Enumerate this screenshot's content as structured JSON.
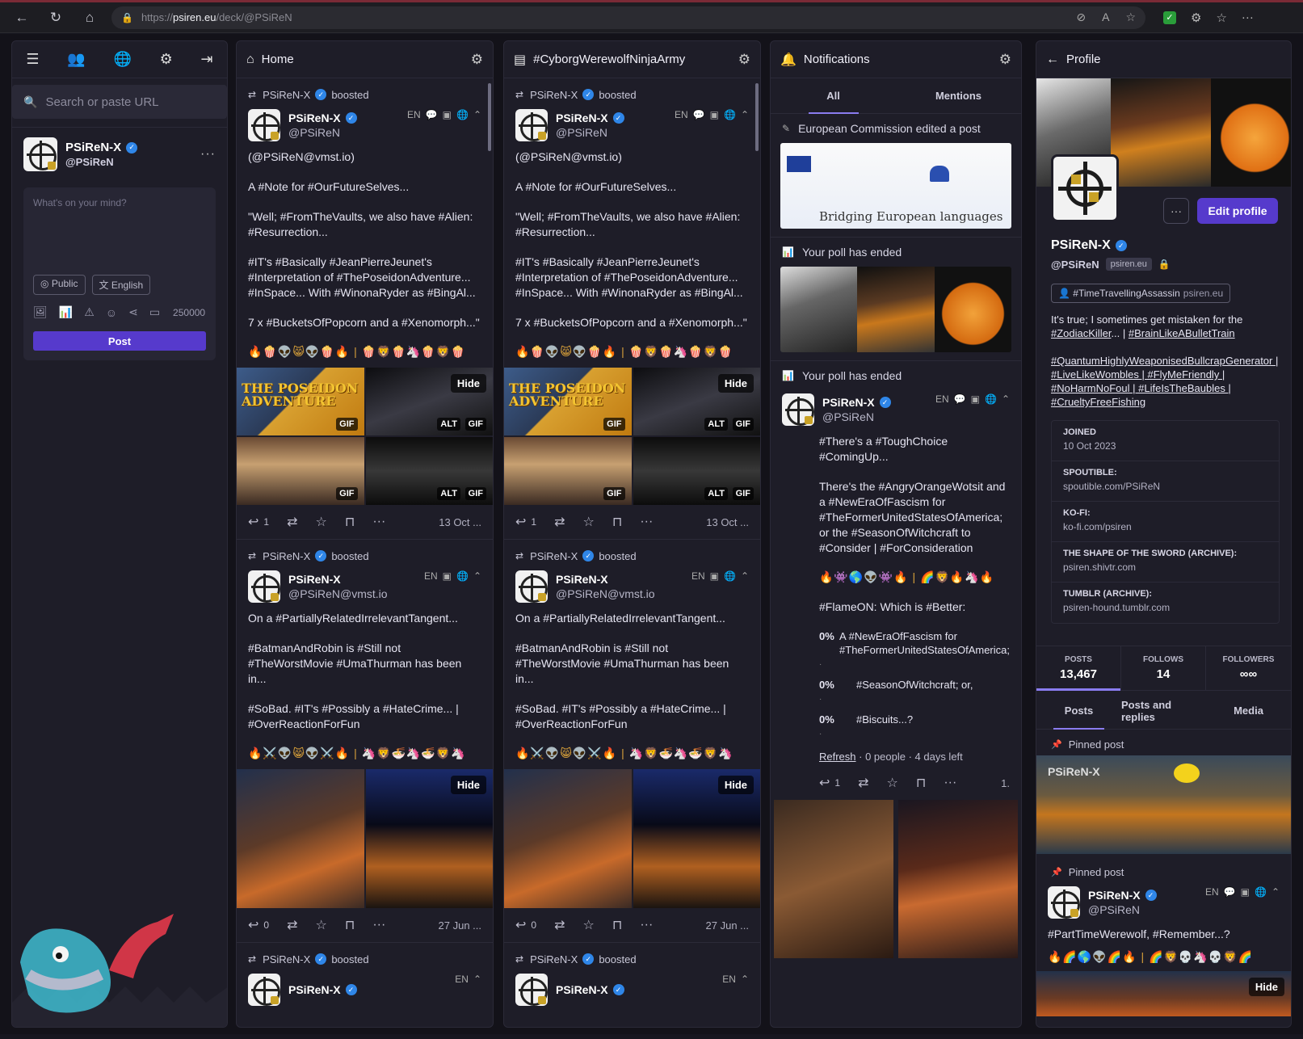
{
  "browser": {
    "url_proto": "https://",
    "url_domain": "psiren.eu",
    "url_path": "/deck/@PSiReN"
  },
  "sidebar": {
    "search_placeholder": "Search or paste URL",
    "user": {
      "display_name": "PSiReN-X",
      "handle": "@PSiReN"
    },
    "compose": {
      "placeholder": "What's on your mind?",
      "visibility": "Public",
      "language": "English",
      "char_count": "250000",
      "post_label": "Post"
    }
  },
  "home": {
    "title": "Home",
    "posts": [
      {
        "boost_user": "PSiReN-X",
        "boost_label": "boosted",
        "display_name": "PSiReN-X",
        "handle": "@PSiReN",
        "lang": "EN",
        "paragraphs": [
          "(@PSiReN@vmst.io)",
          "A #Note for #OurFutureSelves...",
          "\"Well; #FromTheVaults, we also have #Alien: #Resurrection...",
          "#IT's #Basically #JeanPierreJeunet's #Interpretation of  #ThePoseidonAdventure... #InSpace... With #WinonaRyder as #BingAl...",
          "7 x #BucketsOfPopcorn and a #Xenomorph...\""
        ],
        "emoji": "🔥🍿👽😸👽🍿🔥 | 🍿🦁🍿🦄🍿🦁🍿",
        "media_title": "THE POSEIDON ADVENTURE",
        "badge_gif": "GIF",
        "badge_alt": "ALT",
        "hide_label": "Hide",
        "replies": "1",
        "date": "13 Oct ..."
      },
      {
        "boost_user": "PSiReN-X",
        "boost_label": "boosted",
        "display_name": "PSiReN-X",
        "handle": "@PSiReN@vmst.io",
        "lang": "EN",
        "paragraphs": [
          "On a #PartiallyRelatedIrrelevantTangent...",
          "#BatmanAndRobin is #Still not #TheWorstMovie #UmaThurman has been in...",
          "#SoBad. #IT's #Possibly a #HateCrime...  | #OverReactionForFun"
        ],
        "emoji": "🔥⚔️👽😸👽⚔️🔥 | 🦄🦁🍜🦄🍜🦁🦄",
        "hide_label": "Hide",
        "replies": "0",
        "date": "27 Jun ..."
      },
      {
        "boost_user": "PSiReN-X",
        "boost_label": "boosted",
        "display_name": "PSiReN-X",
        "lang": "EN"
      }
    ]
  },
  "hashtag_col": {
    "title": "#CyborgWerewolfNinjaArmy"
  },
  "notifications": {
    "title": "Notifications",
    "tab_all": "All",
    "tab_mentions": "Mentions",
    "edit_notice": "European Commission edited a post",
    "eu_image_text": "Bridging European languages",
    "poll_ended_1": "Your poll has ended",
    "poll_ended_2": "Your poll has ended",
    "poll_post": {
      "display_name": "PSiReN-X",
      "handle": "@PSiReN",
      "lang": "EN",
      "paragraphs": [
        "#There's a #ToughChoice #ComingUp...",
        "There's the #AngryOrangeWotsit and a #NewEraOfFascism for #TheFormerUnitedStatesOfAmerica; or the #SeasonOfWitchcraft to #Consider | #ForConsideration"
      ],
      "emoji": "🔥👾🌎👽👾🔥 | 🌈🦁🔥🦄🔥",
      "question": "#FlameON: Which is #Better:",
      "options": [
        {
          "pct": "0%",
          "label": "A #NewEraOfFascism for #TheFormerUnitedStatesOfAmerica;"
        },
        {
          "pct": "0%",
          "label": "#SeasonOfWitchcraft; or,"
        },
        {
          "pct": "0%",
          "label": "#Biscuits...?"
        }
      ],
      "refresh": "Refresh",
      "poll_meta": " · 0 people · 4 days left",
      "replies": "1",
      "date": "1."
    }
  },
  "profile": {
    "title": "Profile",
    "display_name": "PSiReN-X",
    "handle": "@PSiReN",
    "domain": "psiren.eu",
    "edit_label": "Edit profile",
    "tag_pill": "#TimeTravellingAssassin",
    "tag_pill_domain": "psiren.eu",
    "bio_line1": "It's true; I sometimes get mistaken for the ",
    "bio_tag1": "#ZodiacKiller",
    "bio_mid": "... | ",
    "bio_tag2": "#BrainLikeABulletTrain",
    "bio_tags": "#QuantumHighlyWeaponisedBullcrapGenerator | #LiveLikeWombles | #FlyMeFriendly | #NoHarmNoFoul | #LifeIsTheBaubles | #CrueltyFreeFishing",
    "fields": [
      {
        "k": "JOINED",
        "v": "10 Oct 2023"
      },
      {
        "k": "SPOUTIBLE:",
        "v": "spoutible.com/PSiReN"
      },
      {
        "k": "KO-FI:",
        "v": "ko-fi.com/psiren"
      },
      {
        "k": "THE SHAPE OF THE SWORD (ARCHIVE):",
        "v": "psiren.shivtr.com"
      },
      {
        "k": "TUMBLR (ARCHIVE):",
        "v": "psiren-hound.tumblr.com"
      }
    ],
    "stats": {
      "posts_label": "POSTS",
      "posts": "13,467",
      "follows_label": "FOLLOWS",
      "follows": "14",
      "followers_label": "FOLLOWERS",
      "followers": "∞∞"
    },
    "tabs": [
      "Posts",
      "Posts and replies",
      "Media"
    ],
    "pinned_label": "Pinned post",
    "pinned_post": {
      "display_name": "PSiReN-X",
      "handle": "@PSiReN",
      "lang": "EN",
      "text": "#PartTimeWerewolf, #Remember...?",
      "emoji": "🔥🌈🌎👽🌈🔥 | 🌈🦁💀🦄💀🦁🌈",
      "hide_label": "Hide"
    }
  }
}
